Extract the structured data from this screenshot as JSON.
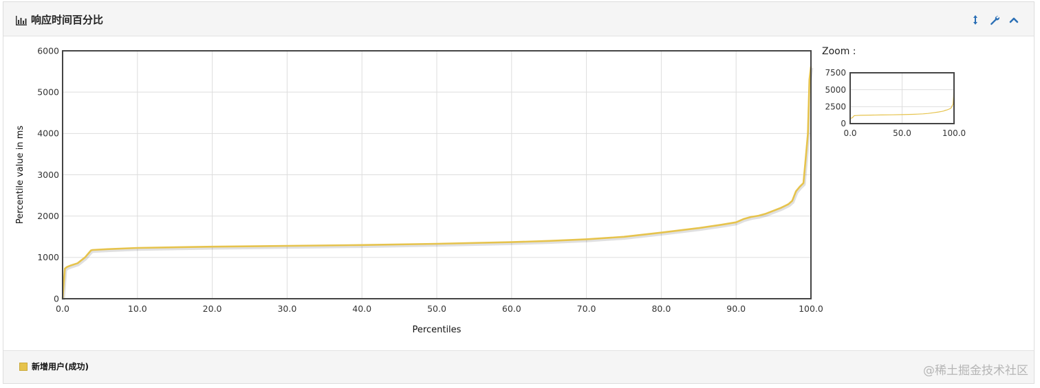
{
  "panel": {
    "title": "响应时间百分比",
    "icons": [
      "bar-chart-icon",
      "resize-vertical-icon",
      "wrench-icon",
      "chevron-up-icon"
    ]
  },
  "zoom": {
    "title": "Zoom :"
  },
  "footer": {
    "legend_label": "新增用户(成功)",
    "watermark": "@稀土掘金技术社区"
  },
  "colors": {
    "series": "#e6c34c",
    "grid": "#dddddd",
    "frame": "#444444"
  },
  "chart_data": [
    {
      "type": "line",
      "title": "",
      "xlabel": "Percentiles",
      "ylabel": "Percentile value in ms",
      "xlim": [
        0,
        100
      ],
      "ylim": [
        0,
        6000
      ],
      "xticks": [
        "0.0",
        "10.0",
        "20.0",
        "30.0",
        "40.0",
        "50.0",
        "60.0",
        "70.0",
        "80.0",
        "90.0",
        "100.0"
      ],
      "yticks": [
        "0",
        "1000",
        "2000",
        "3000",
        "4000",
        "5000",
        "6000"
      ],
      "grid": true,
      "legend": "bottom-left",
      "series": [
        {
          "name": "新增用户(成功)",
          "x": [
            0,
            0.3,
            0.6,
            1,
            2,
            3,
            3.8,
            4,
            6,
            10,
            20,
            30,
            40,
            50,
            60,
            65,
            70,
            75,
            80,
            85,
            88,
            90,
            91,
            92,
            93,
            94,
            95,
            96,
            97,
            97.5,
            98,
            98.5,
            99,
            99.3,
            99.6,
            99.8,
            100
          ],
          "y": [
            0,
            730,
            770,
            800,
            860,
            1000,
            1170,
            1180,
            1200,
            1230,
            1260,
            1280,
            1300,
            1330,
            1370,
            1400,
            1440,
            1500,
            1600,
            1710,
            1790,
            1850,
            1930,
            1980,
            2010,
            2060,
            2130,
            2200,
            2290,
            2370,
            2600,
            2710,
            2800,
            3400,
            4000,
            5300,
            5620
          ]
        }
      ]
    },
    {
      "type": "line",
      "title": "Zoom :",
      "xlim": [
        0,
        100
      ],
      "ylim": [
        0,
        7500
      ],
      "xticks": [
        "0.0",
        "50.0",
        "100.0"
      ],
      "yticks": [
        "0",
        "2500",
        "5000",
        "7500"
      ],
      "grid": true,
      "series": [
        {
          "x": [
            0,
            0.3,
            0.6,
            1,
            2,
            3,
            3.8,
            4,
            6,
            10,
            20,
            30,
            40,
            50,
            60,
            65,
            70,
            75,
            80,
            85,
            88,
            90,
            91,
            92,
            93,
            94,
            95,
            96,
            97,
            97.5,
            98,
            98.5,
            99,
            99.3,
            99.6,
            99.8,
            100
          ],
          "y": [
            0,
            730,
            770,
            800,
            860,
            1000,
            1170,
            1180,
            1200,
            1230,
            1260,
            1280,
            1300,
            1330,
            1370,
            1400,
            1440,
            1500,
            1600,
            1710,
            1790,
            1850,
            1930,
            1980,
            2010,
            2060,
            2130,
            2200,
            2290,
            2370,
            2600,
            2710,
            2800,
            3400,
            4000,
            5300,
            5620
          ]
        }
      ]
    }
  ]
}
